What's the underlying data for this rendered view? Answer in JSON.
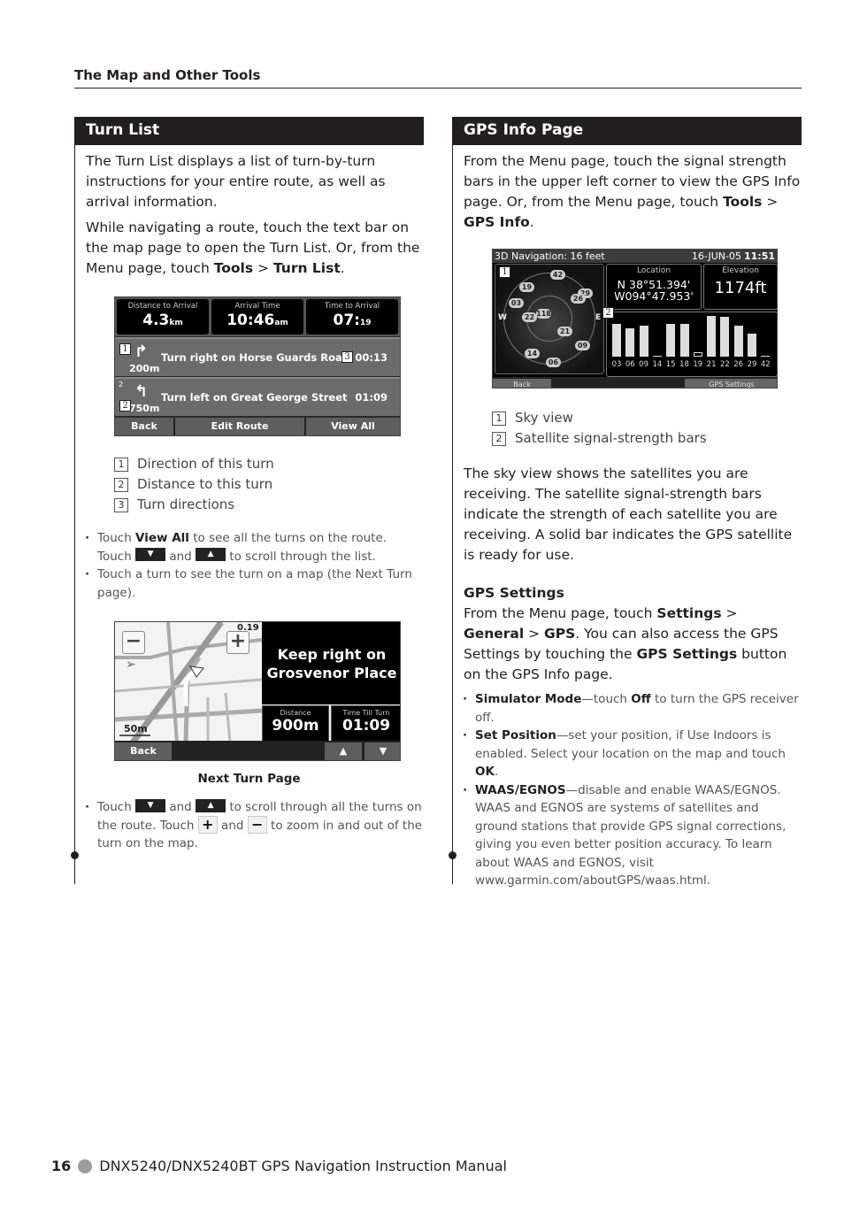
{
  "running_head": "The Map and Other Tools",
  "turn_list": {
    "title": "Turn List",
    "para1": "The Turn List displays a list of turn-by-turn instructions for your entire route, as well as arrival information.",
    "para2_pre": "While navigating a route, touch the text bar on the map page to open the Turn List. Or, from the Menu page, touch ",
    "para2_bold1": "Tools",
    "para2_sep": " > ",
    "para2_bold2": "Turn List",
    "para2_end": ".",
    "screen": {
      "top_cells": [
        {
          "label": "Distance to Arrival",
          "value": "4.3",
          "unit": "km"
        },
        {
          "label": "Arrival Time",
          "value": "10:46",
          "unit": "am"
        },
        {
          "label": "Time to Arrival",
          "value": "07:",
          "unit": "19"
        }
      ],
      "turns": [
        {
          "num": "1",
          "arrow": "turn-right-arrow",
          "distance": "200m",
          "instruction": "Turn right on Horse Guards Road",
          "time": "00:13"
        },
        {
          "num": "2",
          "arrow": "turn-left-arrow",
          "distance": "750m",
          "instruction": "Turn left on Great George Street",
          "time": "01:09"
        }
      ],
      "buttons": {
        "back": "Back",
        "edit_route": "Edit Route",
        "view_all": "View All"
      }
    },
    "callouts": [
      "1",
      "2",
      "3"
    ],
    "legend": [
      {
        "num": "1",
        "text": "Direction of this turn"
      },
      {
        "num": "2",
        "text": "Distance to this turn"
      },
      {
        "num": "3",
        "text": "Turn directions"
      }
    ],
    "bullet1": {
      "pre": "Touch ",
      "bold": "View All",
      "mid": " to see all the turns on the route. Touch ",
      "and": " and ",
      "post": " to scroll through the list."
    },
    "bullet2": "Touch a turn to see the turn on a map (the Next Turn page).",
    "icons": {
      "down": "▼",
      "up": "▲",
      "plus": "+",
      "minus": "−"
    }
  },
  "next_turn": {
    "screen": {
      "instruction": "Keep right on Grosvenor Place",
      "zoom_value": "0.19",
      "scale": "50m",
      "distance_label": "Distance",
      "distance_value": "900m",
      "time_label": "Time Till Turn",
      "time_value": "01:09",
      "back": "Back"
    },
    "caption": "Next Turn Page",
    "bullet": {
      "pre": "Touch ",
      "and1": " and ",
      "mid": " to scroll through all the turns on the route. Touch ",
      "and2": " and ",
      "post": " to zoom in and out of the turn on the map."
    }
  },
  "gps_info": {
    "title": "GPS Info Page",
    "para_pre": "From the Menu page, touch the signal strength bars in the upper left corner to view the GPS Info page. Or, from the Menu page, touch ",
    "bold1": "Tools",
    "sep": " > ",
    "bold2": "GPS Info",
    "end": ".",
    "screen": {
      "title": "3D Navigation: 16 feet",
      "date": "16-JUN-05",
      "time": "11:51",
      "location_label": "Location",
      "lat": "N  38°51.394'",
      "lon": "W094°47.953'",
      "elevation_label": "Elevation",
      "elevation": "1174ft",
      "compass_w": "W",
      "compass_e": "E",
      "satellites": [
        "42",
        "19",
        "29",
        "26",
        "03",
        "22",
        "118",
        "21",
        "09",
        "14",
        "06"
      ],
      "signal_bars": [
        {
          "sat": "03",
          "strength": 0.78,
          "solid": true
        },
        {
          "sat": "06",
          "strength": 0.66,
          "solid": true
        },
        {
          "sat": "09",
          "strength": 0.72,
          "solid": true
        },
        {
          "sat": "14",
          "strength": 0.02,
          "solid": true
        },
        {
          "sat": "15",
          "strength": 0.78,
          "solid": true
        },
        {
          "sat": "18",
          "strength": 0.78,
          "solid": true
        },
        {
          "sat": "19",
          "strength": 0.1,
          "solid": false
        },
        {
          "sat": "21",
          "strength": 0.96,
          "solid": true
        },
        {
          "sat": "22",
          "strength": 0.93,
          "solid": true
        },
        {
          "sat": "26",
          "strength": 0.72,
          "solid": true
        },
        {
          "sat": "29",
          "strength": 0.55,
          "solid": true
        },
        {
          "sat": "42",
          "strength": 0.02,
          "solid": true
        }
      ],
      "back": "Back",
      "gps_settings": "GPS Settings"
    },
    "callouts": [
      "1",
      "2"
    ],
    "legend": [
      {
        "num": "1",
        "text": "Sky view"
      },
      {
        "num": "2",
        "text": "Satellite signal-strength bars"
      }
    ],
    "para2": "The sky view shows the satellites you are receiving. The satellite signal-strength bars indicate the strength of each satellite you are receiving. A solid bar indicates the GPS satellite is ready for use."
  },
  "gps_settings": {
    "title": "GPS Settings",
    "p_pre": "From the Menu page, touch ",
    "p_b1": "Settings",
    "p_sep1": " > ",
    "p_b2": "General",
    "p_sep2": " > ",
    "p_b3": "GPS",
    "p_mid": ". You can also access the GPS Settings by touching the ",
    "p_b4": "GPS Settings",
    "p_end": " button on the GPS Info page.",
    "bullets": [
      {
        "bold": "Simulator Mode",
        "pre": "—touch ",
        "bold2": "Off",
        "post": " to turn the GPS receiver off."
      },
      {
        "bold": "Set Position",
        "pre": "—set your position, if Use Indoors is enabled. Select your location on the map and touch ",
        "bold2": "OK",
        "post": "."
      },
      {
        "bold": "WAAS/EGNOS",
        "pre": "—disable and enable WAAS/EGNOS. WAAS and EGNOS are systems of satellites and ground stations that provide GPS signal corrections, giving you even better position accuracy. To learn about WAAS and EGNOS, visit www.garmin.com/aboutGPS/waas.html.",
        "bold2": "",
        "post": ""
      }
    ]
  },
  "footer": {
    "page_number": "16",
    "manual_title": "DNX5240/DNX5240BT GPS Navigation Instruction Manual"
  }
}
